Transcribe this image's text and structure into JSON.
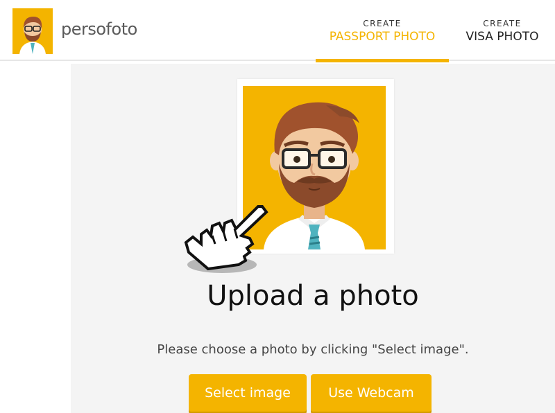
{
  "header": {
    "brand": "persofoto",
    "logo_icon": "bearded-man-avatar-icon",
    "tabs": [
      {
        "small": "CREATE",
        "label": "PASSPORT PHOTO",
        "active": true
      },
      {
        "small": "CREATE",
        "label": "VISA PHOTO",
        "active": false
      }
    ]
  },
  "main": {
    "illustration_icon": "bearded-man-portrait-icon",
    "pointer_icon": "hand-pointer-icon",
    "title": "Upload a photo",
    "instructions": "Please choose a photo by clicking \"Select image\".",
    "buttons": {
      "select_label": "Select image",
      "webcam_label": "Use Webcam"
    }
  },
  "colors": {
    "accent": "#f4b400",
    "background": "#f4f4f4",
    "text": "#111111"
  }
}
